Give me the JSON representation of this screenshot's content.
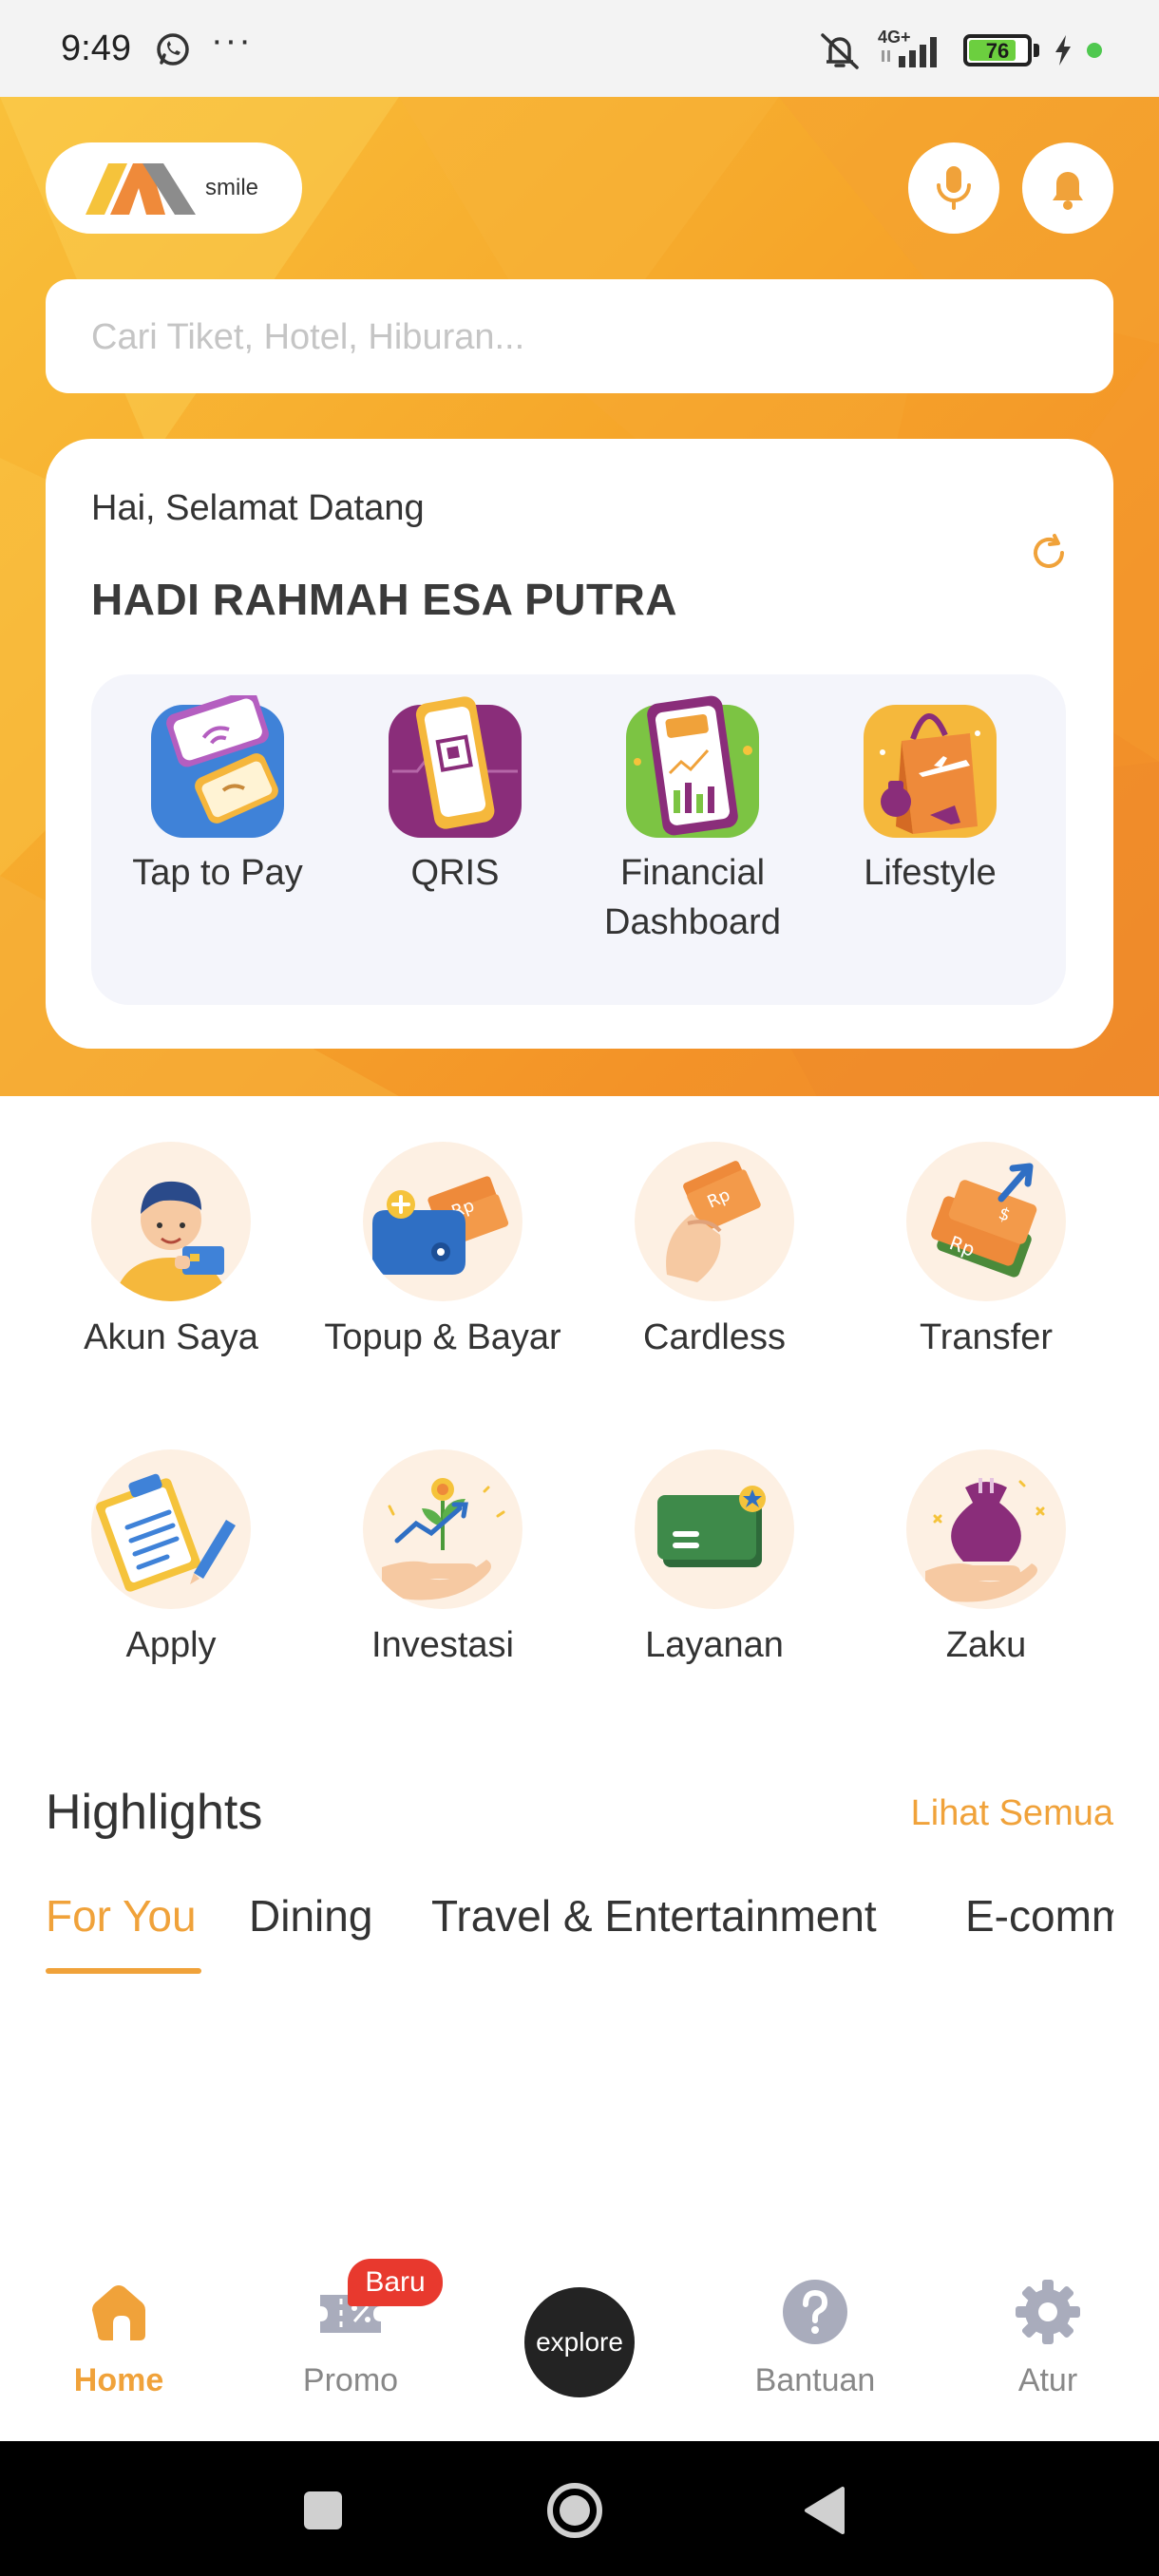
{
  "status_bar": {
    "time": "9:49",
    "more_dots": "···",
    "network": "4G+",
    "battery": "76",
    "battery_level": 0.76
  },
  "header": {
    "logo_text": "smile",
    "search_placeholder": "Cari Tiket, Hotel, Hiburan..."
  },
  "welcome": {
    "greeting": "Hai, Selamat Datang",
    "user_name": "HADI RAHMAH ESA PUTRA",
    "quick_actions": [
      {
        "label": "Tap to Pay",
        "icon": "tap-to-pay-icon"
      },
      {
        "label": "QRIS",
        "icon": "qris-icon"
      },
      {
        "label": "Financial Dashboard",
        "icon": "financial-dashboard-icon"
      },
      {
        "label": "Lifestyle",
        "icon": "lifestyle-icon"
      }
    ]
  },
  "menu": [
    {
      "label": "Akun Saya",
      "icon": "account-icon"
    },
    {
      "label": "Topup & Bayar",
      "icon": "topup-wallet-icon"
    },
    {
      "label": "Cardless",
      "icon": "cardless-icon"
    },
    {
      "label": "Transfer",
      "icon": "transfer-icon"
    },
    {
      "label": "Apply",
      "icon": "apply-clipboard-icon"
    },
    {
      "label": "Investasi",
      "icon": "investment-icon"
    },
    {
      "label": "Layanan",
      "icon": "service-card-icon"
    },
    {
      "label": "Zaku",
      "icon": "zaku-pouch-icon"
    }
  ],
  "highlights": {
    "title": "Highlights",
    "see_all": "Lihat Semua",
    "tabs": [
      "For You",
      "Dining",
      "Travel & Entertainment",
      "E-commerce"
    ]
  },
  "bottom_nav": {
    "items": [
      {
        "label": "Home",
        "icon": "home-icon"
      },
      {
        "label": "Promo",
        "icon": "promo-ticket-icon"
      },
      {
        "label": "explore",
        "icon": "explore-button"
      },
      {
        "label": "Bantuan",
        "icon": "help-icon"
      },
      {
        "label": "Atur",
        "icon": "settings-gear-icon"
      }
    ],
    "promo_badge": "Baru"
  },
  "colors": {
    "accent": "#f0a23a",
    "hero_orange": "#f6a62a",
    "badge_red": "#e8392e"
  }
}
